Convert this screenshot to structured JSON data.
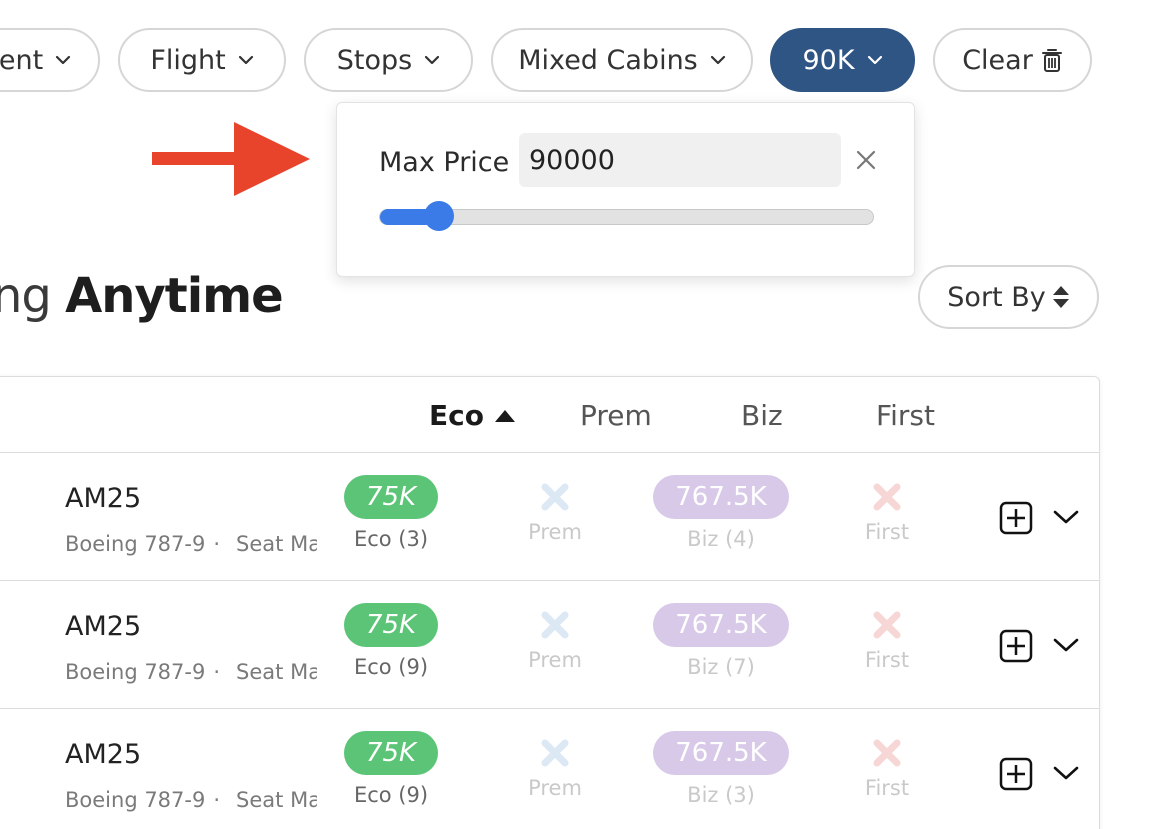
{
  "filters": [
    {
      "label": "ent",
      "active": false
    },
    {
      "label": "Flight",
      "active": false
    },
    {
      "label": "Stops",
      "active": false
    },
    {
      "label": "Mixed Cabins",
      "active": false
    },
    {
      "label": "90K",
      "active": true
    }
  ],
  "clear_label": "Clear",
  "popover": {
    "label": "Max Price",
    "value": "90000",
    "slider_level_percent": 12
  },
  "heading": {
    "prefix": "ng ",
    "bold": "Anytime"
  },
  "sort_label": "Sort By",
  "table": {
    "columns": [
      "Eco",
      "Prem",
      "Biz",
      "First"
    ],
    "sorted_column": "Eco",
    "rows": [
      {
        "flight": "AM25",
        "aircraft": "Boeing 787-9",
        "separator": "·",
        "seat": "Seat Map",
        "eco": {
          "price": "75K",
          "sub": "Eco (3)"
        },
        "prem": {
          "sub": "Prem"
        },
        "biz": {
          "price": "767.5K",
          "sub": "Biz (4)"
        },
        "first": {
          "sub": "First"
        }
      },
      {
        "flight": "AM25",
        "aircraft": "Boeing 787-9",
        "separator": "·",
        "seat": "Seat Map",
        "eco": {
          "price": "75K",
          "sub": "Eco (9)"
        },
        "prem": {
          "sub": "Prem"
        },
        "biz": {
          "price": "767.5K",
          "sub": "Biz (7)"
        },
        "first": {
          "sub": "First"
        }
      },
      {
        "flight": "AM25",
        "aircraft": "Boeing 787-9",
        "separator": "·",
        "seat": "Seat Map",
        "eco": {
          "price": "75K",
          "sub": "Eco (9)"
        },
        "prem": {
          "sub": "Prem"
        },
        "biz": {
          "price": "767.5K",
          "sub": "Biz (3)"
        },
        "first": {
          "sub": "First"
        }
      }
    ]
  },
  "colors": {
    "active_chip": "#2f5585",
    "eco_pill": "#5cc476",
    "biz_pill": "#d8c9e9",
    "slider": "#3b7be8",
    "arrow": "#e8432b",
    "prem_x": "#dce9f5",
    "first_x": "#f7d6d6"
  },
  "icons": [
    "chevron-down-icon",
    "trash-icon",
    "close-icon",
    "sort-icon",
    "sort-up-icon",
    "seat-icon",
    "x-icon",
    "plus-square-icon",
    "arrow-right-icon"
  ]
}
